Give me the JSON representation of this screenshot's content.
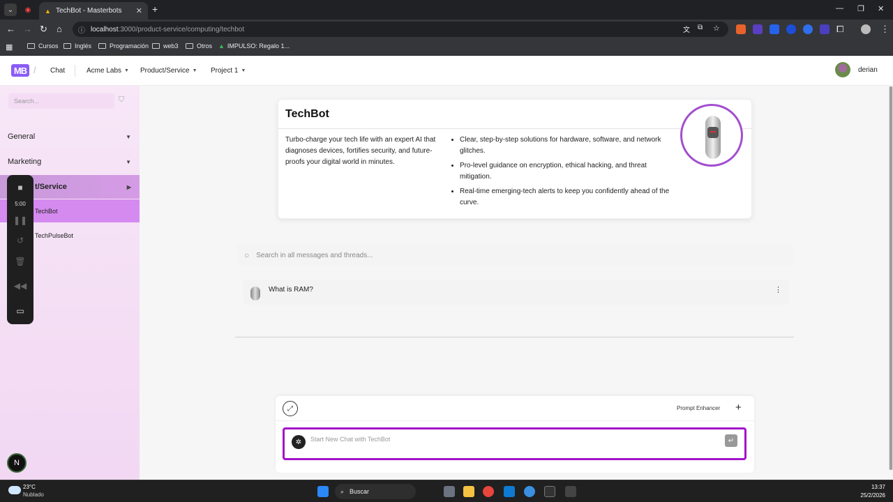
{
  "browser": {
    "tab_title": "TechBot - Masterbots",
    "url_host": "localhost",
    "url_path": ":3000/product-service/computing/techbot",
    "bookmarks": [
      "Cursos",
      "Inglés",
      "Programación",
      "web3",
      "Otros",
      "IMPULSO: Regalo 1..."
    ]
  },
  "header": {
    "logo": "MB",
    "chat": "Chat",
    "menus": [
      "Acme Labs",
      "Product/Service",
      "Project 1"
    ],
    "user": "derian"
  },
  "sidebar": {
    "search_placeholder": "Search...",
    "sections": [
      "General",
      "Marketing",
      "t/Service"
    ],
    "items": [
      "TechBot",
      "TechPulseBot"
    ]
  },
  "recorder": {
    "time": "5:00"
  },
  "bot_card": {
    "title": "TechBot",
    "description": "Turbo-charge your tech life with an expert AI that diagnoses devices, fortifies security, and future-proofs your digital world in minutes.",
    "bullets": [
      "Clear, step-by-step solutions for hardware, software, and network glitches.",
      "Pro-level guidance on encryption, ethical hacking, and threat mitigation.",
      "Real-time emerging-tech alerts to keep you confidently ahead of the curve."
    ]
  },
  "message_search": {
    "placeholder": "Search in all messages and threads..."
  },
  "threads": [
    {
      "title": "What is RAM?"
    }
  ],
  "composer": {
    "prompt_enhancer": "Prompt Enhancer",
    "placeholder": "Start New Chat with TechBot"
  },
  "taskbar": {
    "temperature": "23°C",
    "condition": "Nublado",
    "search": "Buscar",
    "time": "13:37",
    "date": "25/2/2026"
  },
  "colors": {
    "accent": "#a311c9",
    "sidebar_active": "#d58af0",
    "logo": "#8a5cf6"
  }
}
